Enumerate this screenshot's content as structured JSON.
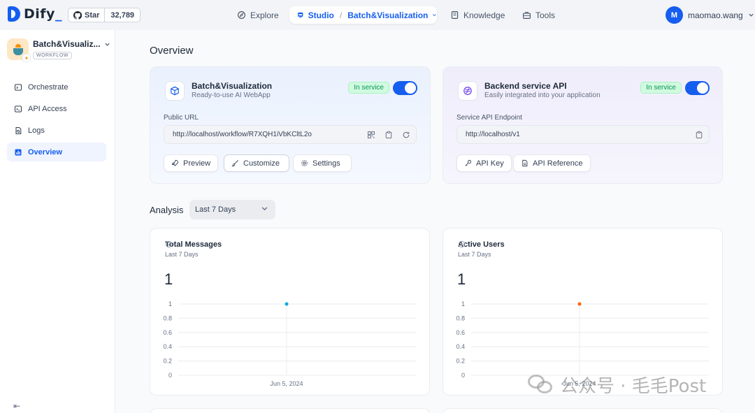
{
  "topnav": {
    "brand": "Dify",
    "github_star": "Star",
    "github_count": "32,789",
    "explore": "Explore",
    "studio": "Studio",
    "studio_app": "Batch&Visualization",
    "knowledge": "Knowledge",
    "tools": "Tools",
    "user_initial": "M",
    "user_name": "maomao.wang"
  },
  "sidebar": {
    "app_name": "Batch&Visualiz...",
    "app_type": "WORKFLOW",
    "items": [
      {
        "label": "Orchestrate",
        "icon": "terminal-icon"
      },
      {
        "label": "API Access",
        "icon": "code-icon"
      },
      {
        "label": "Logs",
        "icon": "file-search-icon"
      },
      {
        "label": "Overview",
        "icon": "bar-chart-icon"
      }
    ],
    "active": "Overview"
  },
  "main": {
    "title": "Overview",
    "webapp": {
      "title": "Batch&Visualization",
      "subtitle": "Ready-to-use AI WebApp",
      "status": "In service",
      "url_label": "Public URL",
      "url": "http://localhost/workflow/R7XQH1iVbKCltL2o",
      "buttons": [
        "Preview",
        "Customize",
        "Settings"
      ]
    },
    "api": {
      "title": "Backend service API",
      "subtitle": "Easily integrated into your application",
      "status": "In service",
      "endpoint_label": "Service API Endpoint",
      "endpoint": "http://localhost/v1",
      "buttons": [
        "API Key",
        "API Reference"
      ]
    },
    "analysis": {
      "label": "Analysis",
      "range": "Last 7 Days"
    },
    "stats": [
      {
        "title": "Total Messages",
        "subtitle": "Last 7 Days",
        "value": "1",
        "color": "#06aed4"
      },
      {
        "title": "Active Users",
        "subtitle": "Last 7 Days",
        "value": "1",
        "color": "#fb6514"
      }
    ]
  },
  "chart_data": [
    {
      "type": "line",
      "x": [
        "Jun 5, 2024"
      ],
      "values": [
        1
      ],
      "ylim": [
        0,
        1
      ],
      "yticks": [
        "1",
        "0.8",
        "0.6",
        "0.4",
        "0.2",
        "0"
      ]
    },
    {
      "type": "line",
      "x": [
        "Jun 5, 2024"
      ],
      "values": [
        1
      ],
      "ylim": [
        0,
        1
      ],
      "yticks": [
        "1",
        "0.8",
        "0.6",
        "0.4",
        "0.2",
        "0"
      ]
    }
  ],
  "watermark": "公众号 · 毛毛Post",
  "colors": {
    "accent": "#155eef",
    "success": "#039855"
  }
}
